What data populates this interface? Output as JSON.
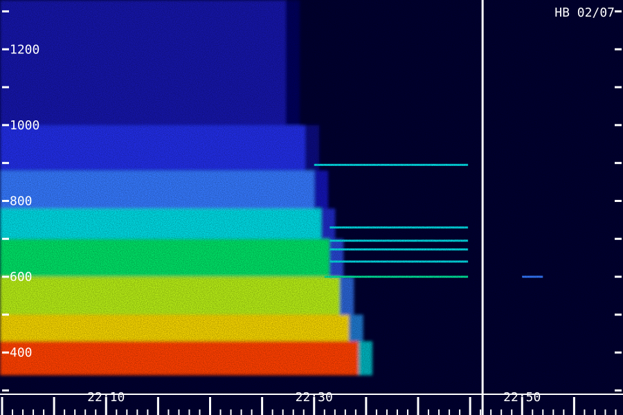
{
  "chart_data": {
    "type": "heatmap",
    "title": "",
    "station_label": "HB 02/07",
    "xlabel": "",
    "ylabel": "",
    "x_tick_labels": [
      "22:10",
      "22:30",
      "22:50"
    ],
    "x_ticks": [
      10,
      30,
      50
    ],
    "xlim": [
      -0.2,
      59.7
    ],
    "y_tick_labels": [
      "400",
      "600",
      "800",
      "1000",
      "1200"
    ],
    "y_ticks": [
      400,
      600,
      800,
      1000,
      1200
    ],
    "ylim": [
      290,
      1330
    ],
    "data_gap_at_minute": 46.2,
    "colormap": [
      "#000030",
      "#1a1adc",
      "#3a6cff",
      "#00e0e0",
      "#00e050",
      "#f0f000",
      "#ff8000",
      "#ff1e00"
    ],
    "intensity_scale": "0 = background, 1 = strongest",
    "broadband_emission": [
      {
        "from_frequency": 340,
        "to_frequency": 430,
        "intensity": 0.95
      },
      {
        "from_frequency": 430,
        "to_frequency": 500,
        "intensity": 0.75
      },
      {
        "from_frequency": 500,
        "to_frequency": 600,
        "intensity": 0.68
      },
      {
        "from_frequency": 600,
        "to_frequency": 700,
        "intensity": 0.55
      },
      {
        "from_frequency": 700,
        "to_frequency": 780,
        "intensity": 0.42
      },
      {
        "from_frequency": 780,
        "to_frequency": 880,
        "intensity": 0.3
      },
      {
        "from_frequency": 880,
        "to_frequency": 1000,
        "intensity": 0.18
      },
      {
        "from_frequency": 1000,
        "to_frequency": 1330,
        "intensity": 0.1
      }
    ],
    "emission_end_minute": [
      {
        "frequency": 320,
        "minute": 35
      },
      {
        "frequency": 500,
        "minute": 33
      },
      {
        "frequency": 700,
        "minute": 31
      },
      {
        "frequency": 900,
        "minute": 29.5
      },
      {
        "frequency": 1200,
        "minute": 27
      }
    ],
    "narrowband_lines": [
      {
        "frequency": 895,
        "start_minute": 30,
        "end_minute": 44.8,
        "intensity": 0.42
      },
      {
        "frequency": 730,
        "start_minute": 31.5,
        "end_minute": 44.8,
        "intensity": 0.42
      },
      {
        "frequency": 695,
        "start_minute": 31.5,
        "end_minute": 44.8,
        "intensity": 0.42
      },
      {
        "frequency": 672,
        "start_minute": 31.5,
        "end_minute": 44.8,
        "intensity": 0.42
      },
      {
        "frequency": 640,
        "start_minute": 31.5,
        "end_minute": 44.8,
        "intensity": 0.42
      },
      {
        "frequency": 600,
        "start_minute": 31,
        "end_minute": 44.8,
        "intensity": 0.5
      },
      {
        "frequency": 600,
        "start_minute": 50,
        "end_minute": 52,
        "intensity": 0.3
      }
    ],
    "grid": false
  }
}
